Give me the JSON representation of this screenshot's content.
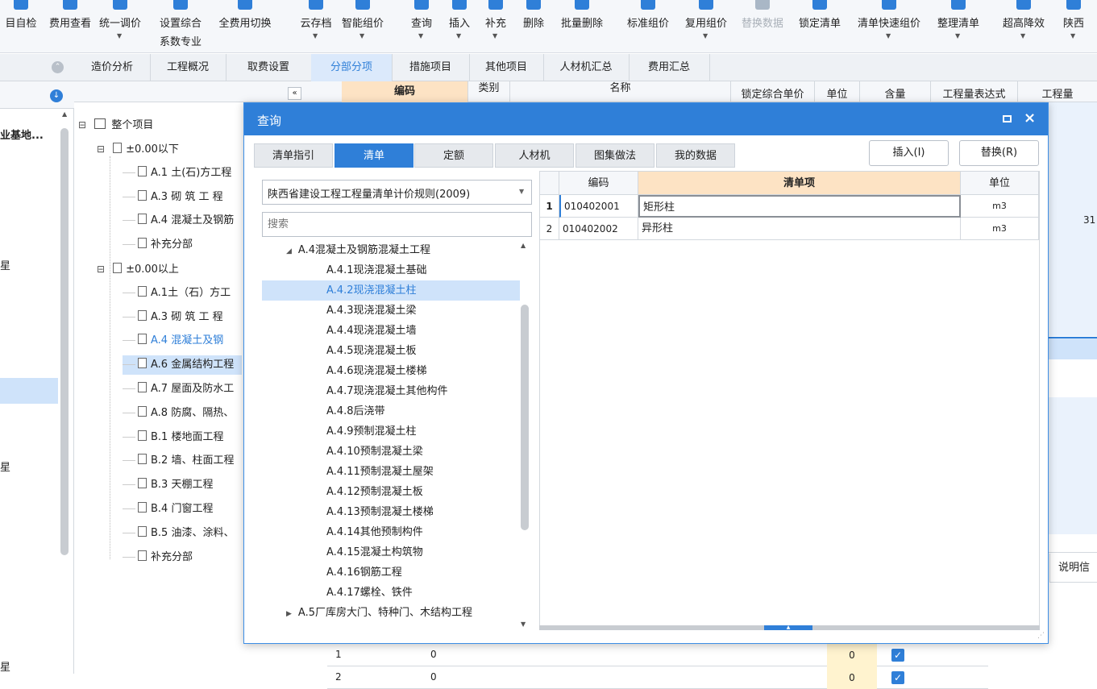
{
  "toolbar": {
    "items": [
      {
        "label": "目自检",
        "caret": false
      },
      {
        "label": "费用查看",
        "caret": false
      },
      {
        "label": "统一调价",
        "caret": true
      },
      {
        "label": "设置综合",
        "label2": "系数专业",
        "caret": false
      },
      {
        "label": "全费用切换",
        "caret": false
      },
      {
        "label": "云存档",
        "caret": true
      },
      {
        "label": "智能组价",
        "caret": true
      },
      {
        "label": "查询",
        "caret": true
      },
      {
        "label": "插入",
        "caret": true
      },
      {
        "label": "补充",
        "caret": true
      },
      {
        "label": "删除",
        "caret": false
      },
      {
        "label": "批量删除",
        "caret": false
      },
      {
        "label": "标准组价",
        "caret": false
      },
      {
        "label": "复用组价",
        "caret": true
      },
      {
        "label": "替换数据",
        "caret": false,
        "disabled": true
      },
      {
        "label": "锁定清单",
        "caret": false
      },
      {
        "label": "清单快速组价",
        "caret": true
      },
      {
        "label": "整理清单",
        "caret": true
      },
      {
        "label": "超高降效",
        "caret": true
      },
      {
        "label": "陕西",
        "caret": true
      }
    ]
  },
  "main_tabs": [
    "造价分析",
    "工程概况",
    "取费设置",
    "分部分项",
    "措施项目",
    "其他项目",
    "人材机汇总",
    "费用汇总"
  ],
  "left_panel": {
    "item1": "业基地...",
    "item2": "星",
    "item3": "星",
    "item4": "星"
  },
  "tree": {
    "root": "整个项目",
    "nodes": [
      {
        "label": "±0.00以下",
        "level": 1,
        "toggle": "⊟"
      },
      {
        "label": "A.1  土(石)方工程",
        "level": 2
      },
      {
        "label": "A.3  砌 筑 工 程",
        "level": 2
      },
      {
        "label": "A.4  混凝土及钢筋",
        "level": 2
      },
      {
        "label": "补充分部",
        "level": 2
      },
      {
        "label": "±0.00以上",
        "level": 1,
        "toggle": "⊟"
      },
      {
        "label": "A.1土（石）方工",
        "level": 2
      },
      {
        "label": "A.3  砌 筑 工 程",
        "level": 2
      },
      {
        "label": "A.4  混凝土及钢",
        "level": 2,
        "highlight": true
      },
      {
        "label": "A.6  金属结构工程",
        "level": 2,
        "selected": true
      },
      {
        "label": "A.7  屋面及防水工",
        "level": 2
      },
      {
        "label": "A.8  防腐、隔热、",
        "level": 2
      },
      {
        "label": "B.1  楼地面工程",
        "level": 2
      },
      {
        "label": "B.2  墙、柱面工程",
        "level": 2
      },
      {
        "label": "B.3  天棚工程",
        "level": 2
      },
      {
        "label": "B.4  门窗工程",
        "level": 2
      },
      {
        "label": "B.5  油漆、涂料、",
        "level": 2
      },
      {
        "label": "补充分部",
        "level": 2
      }
    ]
  },
  "grid_header": {
    "code": "编码",
    "type": "类别",
    "name": "名称",
    "locked_price": "锁定综合单价",
    "unit": "单位",
    "content": "含量",
    "expr": "工程量表达式",
    "qty": "工程量"
  },
  "grid_side": {
    "value": "31",
    "info_label": "说明信"
  },
  "bottom_rows": [
    {
      "no": "1",
      "val": "0",
      "num": "0"
    },
    {
      "no": "2",
      "val": "0",
      "num": "0"
    }
  ],
  "dialog": {
    "title": "查询",
    "tabs": [
      "清单指引",
      "清单",
      "定额",
      "人材机",
      "图集做法",
      "我的数据"
    ],
    "active_tab": 1,
    "insert_label": "插入(I)",
    "replace_label": "替换(R)",
    "spec_select": "陕西省建设工程工程量清单计价规则(2009)",
    "search_placeholder": "搜索",
    "list_parent": "A.4混凝土及钢筋混凝土工程",
    "list_items": [
      "A.4.1现浇混凝土基础",
      "A.4.2现浇混凝土柱",
      "A.4.3现浇混凝土梁",
      "A.4.4现浇混凝土墙",
      "A.4.5现浇混凝土板",
      "A.4.6现浇混凝土楼梯",
      "A.4.7现浇混凝土其他构件",
      "A.4.8后浇带",
      "A.4.9预制混凝土柱",
      "A.4.10预制混凝土梁",
      "A.4.11预制混凝土屋架",
      "A.4.12预制混凝土板",
      "A.4.13预制混凝土楼梯",
      "A.4.14其他预制构件",
      "A.4.15混凝土构筑物",
      "A.4.16钢筋工程",
      "A.4.17螺栓、铁件"
    ],
    "list_selected": 1,
    "list_next": "A.5厂库房大门、特种门、木结构工程",
    "table": {
      "headers": {
        "code": "编码",
        "item": "清单项",
        "unit": "单位"
      },
      "rows": [
        {
          "no": "1",
          "code": "010402001",
          "item": "矩形柱",
          "unit": "m3"
        },
        {
          "no": "2",
          "code": "010402002",
          "item": "异形柱",
          "unit": "m3"
        }
      ]
    }
  },
  "colors": {
    "accent": "#2f7fd8",
    "header_orange": "#fde3c4",
    "selection": "#cfe3fa"
  }
}
